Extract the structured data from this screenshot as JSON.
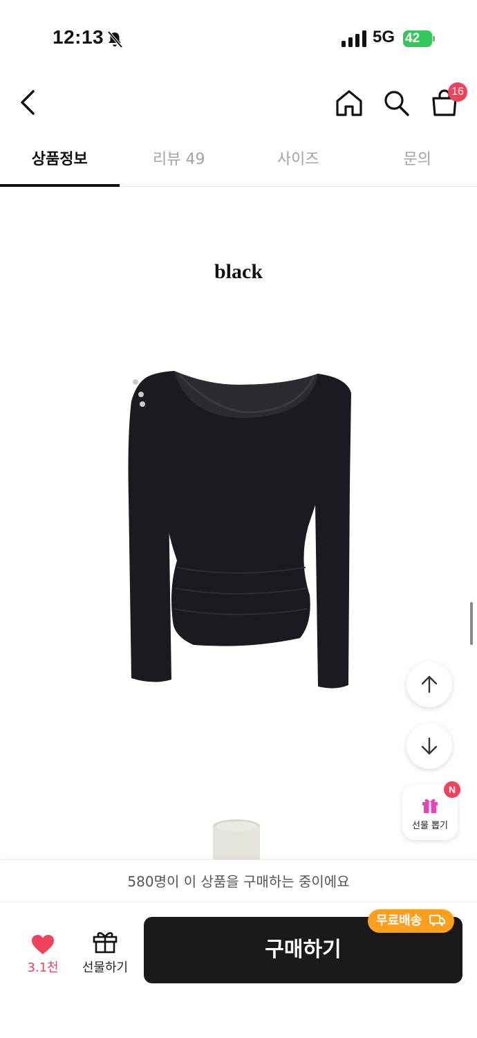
{
  "status": {
    "time": "12:13",
    "network": "5G",
    "battery": "42"
  },
  "header": {
    "cart_count": "16"
  },
  "tabs": [
    {
      "label": "상품정보",
      "active": true
    },
    {
      "label": "리뷰 49",
      "active": false
    },
    {
      "label": "사이즈",
      "active": false
    },
    {
      "label": "문의",
      "active": false
    }
  ],
  "content": {
    "color_title": "black"
  },
  "floating": {
    "gift_pick_label": "선물 뽑기",
    "new_badge": "N"
  },
  "bottom": {
    "purchase_note": "580명이 이 상품을 구매하는 중이에요",
    "like_count": "3.1천",
    "gift_label": "선물하기",
    "buy_label": "구매하기",
    "free_shipping": "무료배송"
  },
  "colors": {
    "accent_red": "#f2415a",
    "shipping_orange": "#ff9f1c",
    "buy_button": "#1a1a1a"
  }
}
